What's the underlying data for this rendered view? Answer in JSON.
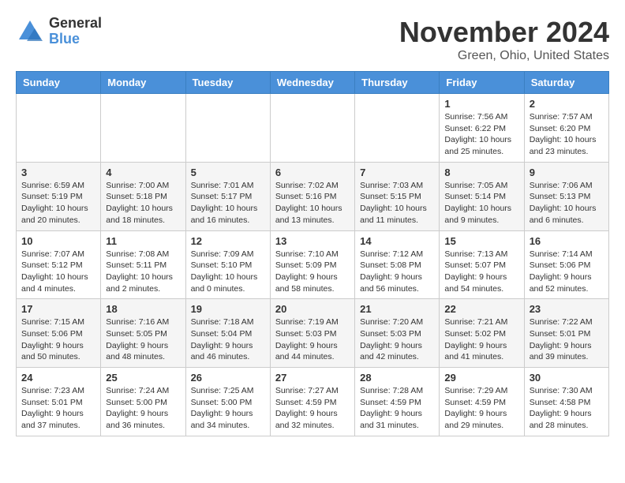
{
  "logo": {
    "general": "General",
    "blue": "Blue"
  },
  "title": "November 2024",
  "location": "Green, Ohio, United States",
  "days_header": [
    "Sunday",
    "Monday",
    "Tuesday",
    "Wednesday",
    "Thursday",
    "Friday",
    "Saturday"
  ],
  "weeks": [
    [
      {
        "day": "",
        "info": ""
      },
      {
        "day": "",
        "info": ""
      },
      {
        "day": "",
        "info": ""
      },
      {
        "day": "",
        "info": ""
      },
      {
        "day": "",
        "info": ""
      },
      {
        "day": "1",
        "info": "Sunrise: 7:56 AM\nSunset: 6:22 PM\nDaylight: 10 hours and 25 minutes."
      },
      {
        "day": "2",
        "info": "Sunrise: 7:57 AM\nSunset: 6:20 PM\nDaylight: 10 hours and 23 minutes."
      }
    ],
    [
      {
        "day": "3",
        "info": "Sunrise: 6:59 AM\nSunset: 5:19 PM\nDaylight: 10 hours and 20 minutes."
      },
      {
        "day": "4",
        "info": "Sunrise: 7:00 AM\nSunset: 5:18 PM\nDaylight: 10 hours and 18 minutes."
      },
      {
        "day": "5",
        "info": "Sunrise: 7:01 AM\nSunset: 5:17 PM\nDaylight: 10 hours and 16 minutes."
      },
      {
        "day": "6",
        "info": "Sunrise: 7:02 AM\nSunset: 5:16 PM\nDaylight: 10 hours and 13 minutes."
      },
      {
        "day": "7",
        "info": "Sunrise: 7:03 AM\nSunset: 5:15 PM\nDaylight: 10 hours and 11 minutes."
      },
      {
        "day": "8",
        "info": "Sunrise: 7:05 AM\nSunset: 5:14 PM\nDaylight: 10 hours and 9 minutes."
      },
      {
        "day": "9",
        "info": "Sunrise: 7:06 AM\nSunset: 5:13 PM\nDaylight: 10 hours and 6 minutes."
      }
    ],
    [
      {
        "day": "10",
        "info": "Sunrise: 7:07 AM\nSunset: 5:12 PM\nDaylight: 10 hours and 4 minutes."
      },
      {
        "day": "11",
        "info": "Sunrise: 7:08 AM\nSunset: 5:11 PM\nDaylight: 10 hours and 2 minutes."
      },
      {
        "day": "12",
        "info": "Sunrise: 7:09 AM\nSunset: 5:10 PM\nDaylight: 10 hours and 0 minutes."
      },
      {
        "day": "13",
        "info": "Sunrise: 7:10 AM\nSunset: 5:09 PM\nDaylight: 9 hours and 58 minutes."
      },
      {
        "day": "14",
        "info": "Sunrise: 7:12 AM\nSunset: 5:08 PM\nDaylight: 9 hours and 56 minutes."
      },
      {
        "day": "15",
        "info": "Sunrise: 7:13 AM\nSunset: 5:07 PM\nDaylight: 9 hours and 54 minutes."
      },
      {
        "day": "16",
        "info": "Sunrise: 7:14 AM\nSunset: 5:06 PM\nDaylight: 9 hours and 52 minutes."
      }
    ],
    [
      {
        "day": "17",
        "info": "Sunrise: 7:15 AM\nSunset: 5:06 PM\nDaylight: 9 hours and 50 minutes."
      },
      {
        "day": "18",
        "info": "Sunrise: 7:16 AM\nSunset: 5:05 PM\nDaylight: 9 hours and 48 minutes."
      },
      {
        "day": "19",
        "info": "Sunrise: 7:18 AM\nSunset: 5:04 PM\nDaylight: 9 hours and 46 minutes."
      },
      {
        "day": "20",
        "info": "Sunrise: 7:19 AM\nSunset: 5:03 PM\nDaylight: 9 hours and 44 minutes."
      },
      {
        "day": "21",
        "info": "Sunrise: 7:20 AM\nSunset: 5:03 PM\nDaylight: 9 hours and 42 minutes."
      },
      {
        "day": "22",
        "info": "Sunrise: 7:21 AM\nSunset: 5:02 PM\nDaylight: 9 hours and 41 minutes."
      },
      {
        "day": "23",
        "info": "Sunrise: 7:22 AM\nSunset: 5:01 PM\nDaylight: 9 hours and 39 minutes."
      }
    ],
    [
      {
        "day": "24",
        "info": "Sunrise: 7:23 AM\nSunset: 5:01 PM\nDaylight: 9 hours and 37 minutes."
      },
      {
        "day": "25",
        "info": "Sunrise: 7:24 AM\nSunset: 5:00 PM\nDaylight: 9 hours and 36 minutes."
      },
      {
        "day": "26",
        "info": "Sunrise: 7:25 AM\nSunset: 5:00 PM\nDaylight: 9 hours and 34 minutes."
      },
      {
        "day": "27",
        "info": "Sunrise: 7:27 AM\nSunset: 4:59 PM\nDaylight: 9 hours and 32 minutes."
      },
      {
        "day": "28",
        "info": "Sunrise: 7:28 AM\nSunset: 4:59 PM\nDaylight: 9 hours and 31 minutes."
      },
      {
        "day": "29",
        "info": "Sunrise: 7:29 AM\nSunset: 4:59 PM\nDaylight: 9 hours and 29 minutes."
      },
      {
        "day": "30",
        "info": "Sunrise: 7:30 AM\nSunset: 4:58 PM\nDaylight: 9 hours and 28 minutes."
      }
    ]
  ]
}
